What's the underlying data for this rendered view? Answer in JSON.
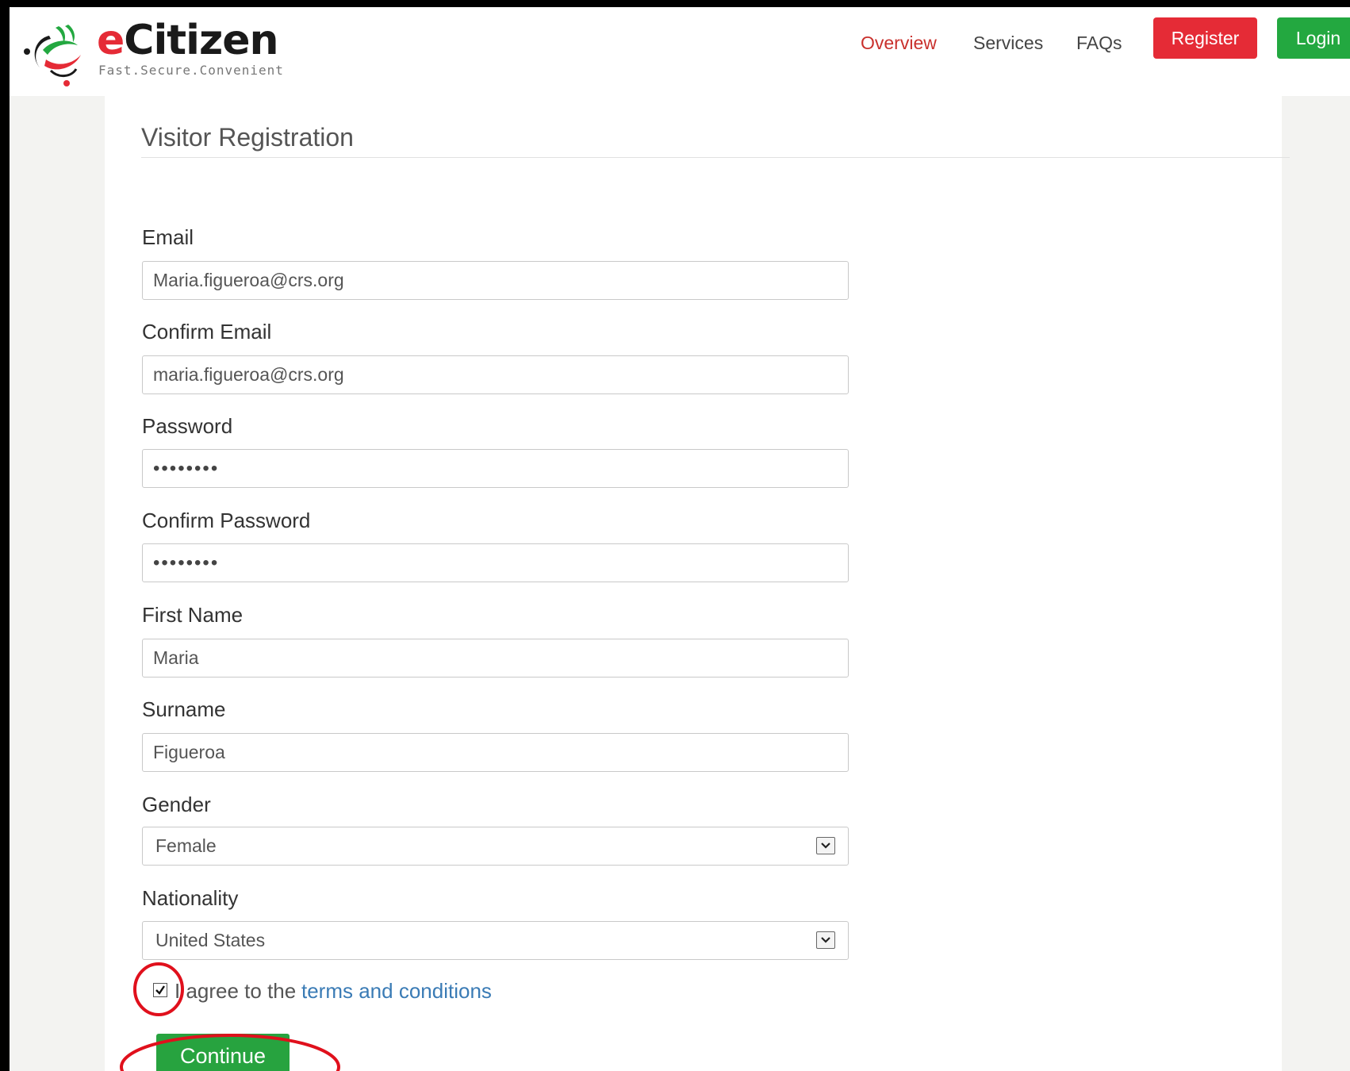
{
  "brand": {
    "name_e": "e",
    "name_rest": "Citizen",
    "tagline": "Fast.Secure.Convenient"
  },
  "nav": {
    "overview": "Overview",
    "services": "Services",
    "faqs": "FAQs",
    "register": "Register",
    "login": "Login"
  },
  "page": {
    "title": "Visitor Registration"
  },
  "form": {
    "email": {
      "label": "Email",
      "value": "Maria.figueroa@crs.org"
    },
    "confirm_email": {
      "label": "Confirm Email",
      "value": "maria.figueroa@crs.org"
    },
    "password": {
      "label": "Password",
      "value": "••••••••"
    },
    "confirm_password": {
      "label": "Confirm Password",
      "value": "••••••••"
    },
    "first_name": {
      "label": "First Name",
      "value": "Maria"
    },
    "surname": {
      "label": "Surname",
      "value": "Figueroa"
    },
    "gender": {
      "label": "Gender",
      "value": "Female"
    },
    "nationality": {
      "label": "Nationality",
      "value": "United States"
    },
    "agree": {
      "checked": true,
      "prefix": "I agree to the",
      "link": "terms and conditions"
    },
    "continue": "Continue"
  },
  "colors": {
    "brand_red": "#e52b36",
    "brand_green": "#23a840",
    "link_blue": "#3a7bb5",
    "annotation_red": "#e0101c"
  }
}
